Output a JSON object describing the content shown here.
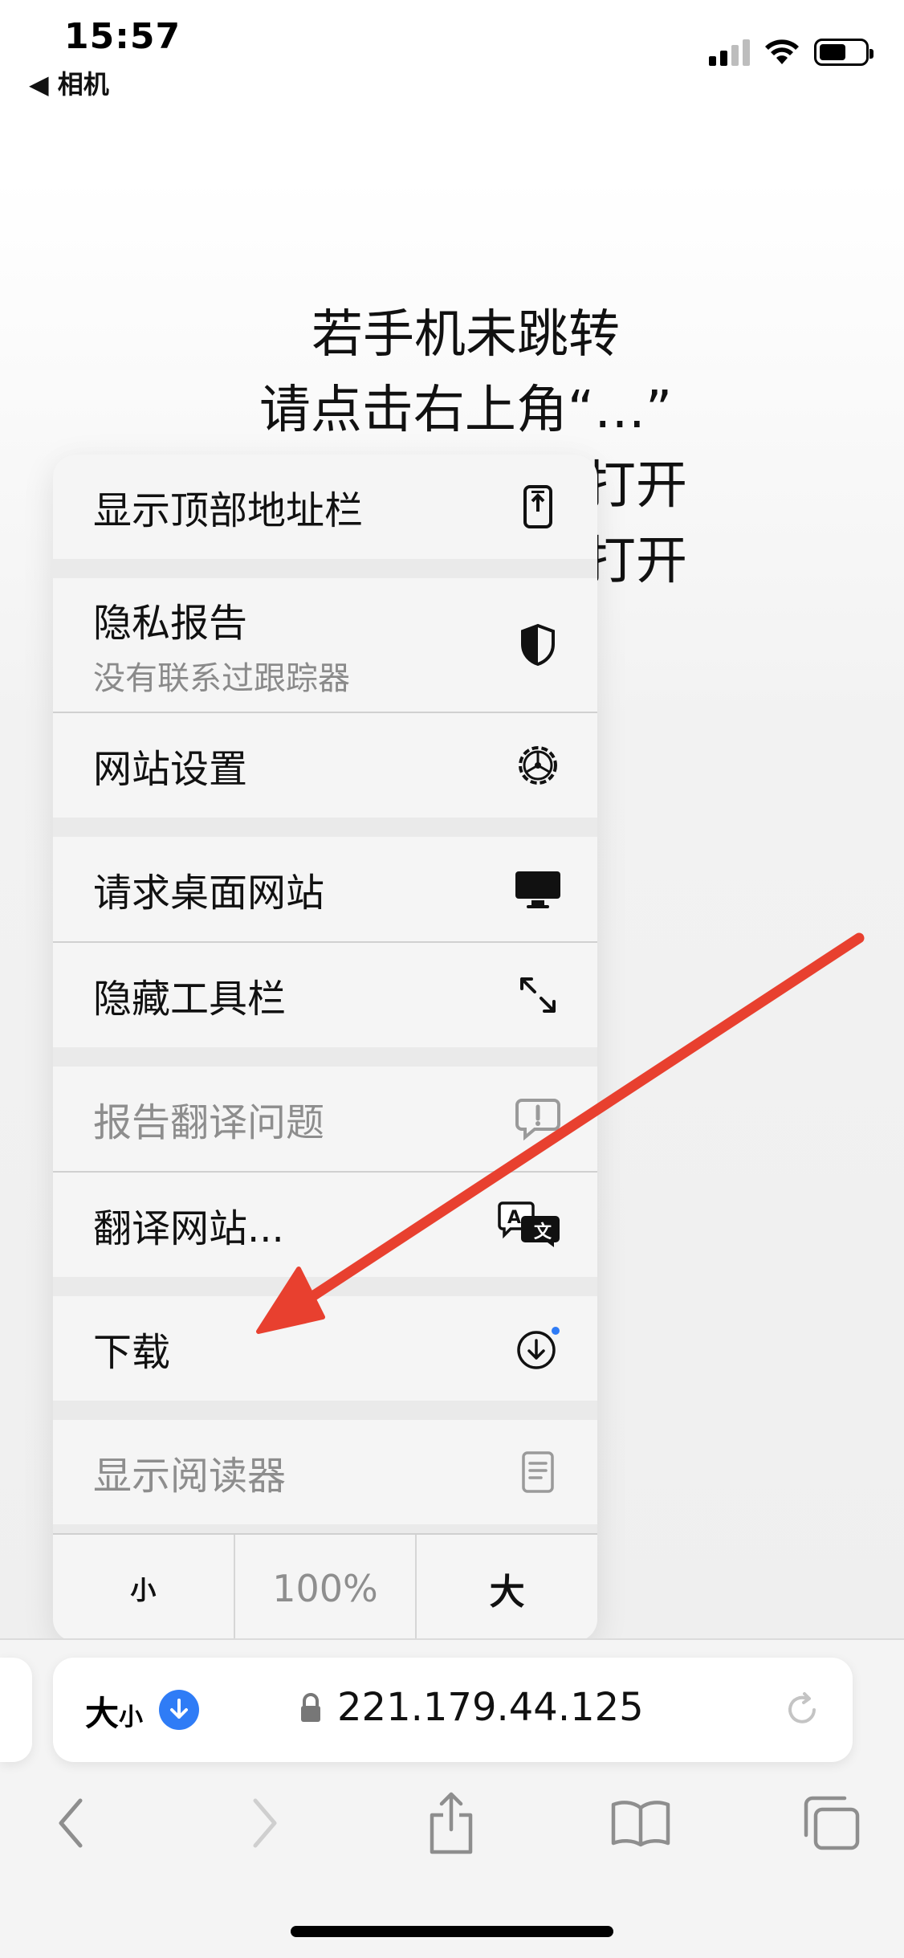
{
  "status_bar": {
    "time": "15:57",
    "back_app": "◀ 相机"
  },
  "page": {
    "lines": [
      "若手机未跳转",
      "请点击右上角“…”",
      "打开",
      "打开"
    ]
  },
  "menu": {
    "show_top_address_bar": "显示顶部地址栏",
    "privacy_report": "隐私报告",
    "privacy_report_sub": "没有联系过跟踪器",
    "website_settings": "网站设置",
    "request_desktop_site": "请求桌面网站",
    "hide_toolbar": "隐藏工具栏",
    "report_translation_issue": "报告翻译问题",
    "translate_website": "翻译网站...",
    "downloads": "下载",
    "show_reader": "显示阅读器",
    "zoom_small": "小",
    "zoom_level": "100%",
    "zoom_large": "大"
  },
  "address_bar": {
    "aa_big": "大",
    "aa_small": "小",
    "url": "221.179.44.125"
  },
  "colors": {
    "accent_blue": "#2f7cf6",
    "annotation_arrow": "#e8402f",
    "disabled_text": "#8d8d8d"
  },
  "icons": [
    "phone-top-icon",
    "shield-icon",
    "gear-icon",
    "desktop-icon",
    "expand-arrows-icon",
    "exclamation-bubble-icon",
    "translate-icon",
    "download-circle-icon",
    "reader-icon",
    "lock-icon",
    "reload-icon",
    "back-chevron-icon",
    "forward-chevron-icon",
    "share-icon",
    "bookmarks-icon",
    "tabs-icon"
  ]
}
